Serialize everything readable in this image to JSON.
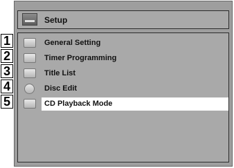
{
  "header": {
    "title": "Setup",
    "icon": "setup-icon"
  },
  "menu": [
    {
      "number": "1",
      "label": "General Setting",
      "icon": "wrench-icon"
    },
    {
      "number": "2",
      "label": "Timer Programming",
      "icon": "timer-icon"
    },
    {
      "number": "3",
      "label": "Title List",
      "icon": "title-list-icon"
    },
    {
      "number": "4",
      "label": "Disc Edit",
      "icon": "disc-icon"
    },
    {
      "number": "5",
      "label": "CD Playback Mode",
      "icon": "cd-playback-icon"
    }
  ],
  "selected_index": 4
}
